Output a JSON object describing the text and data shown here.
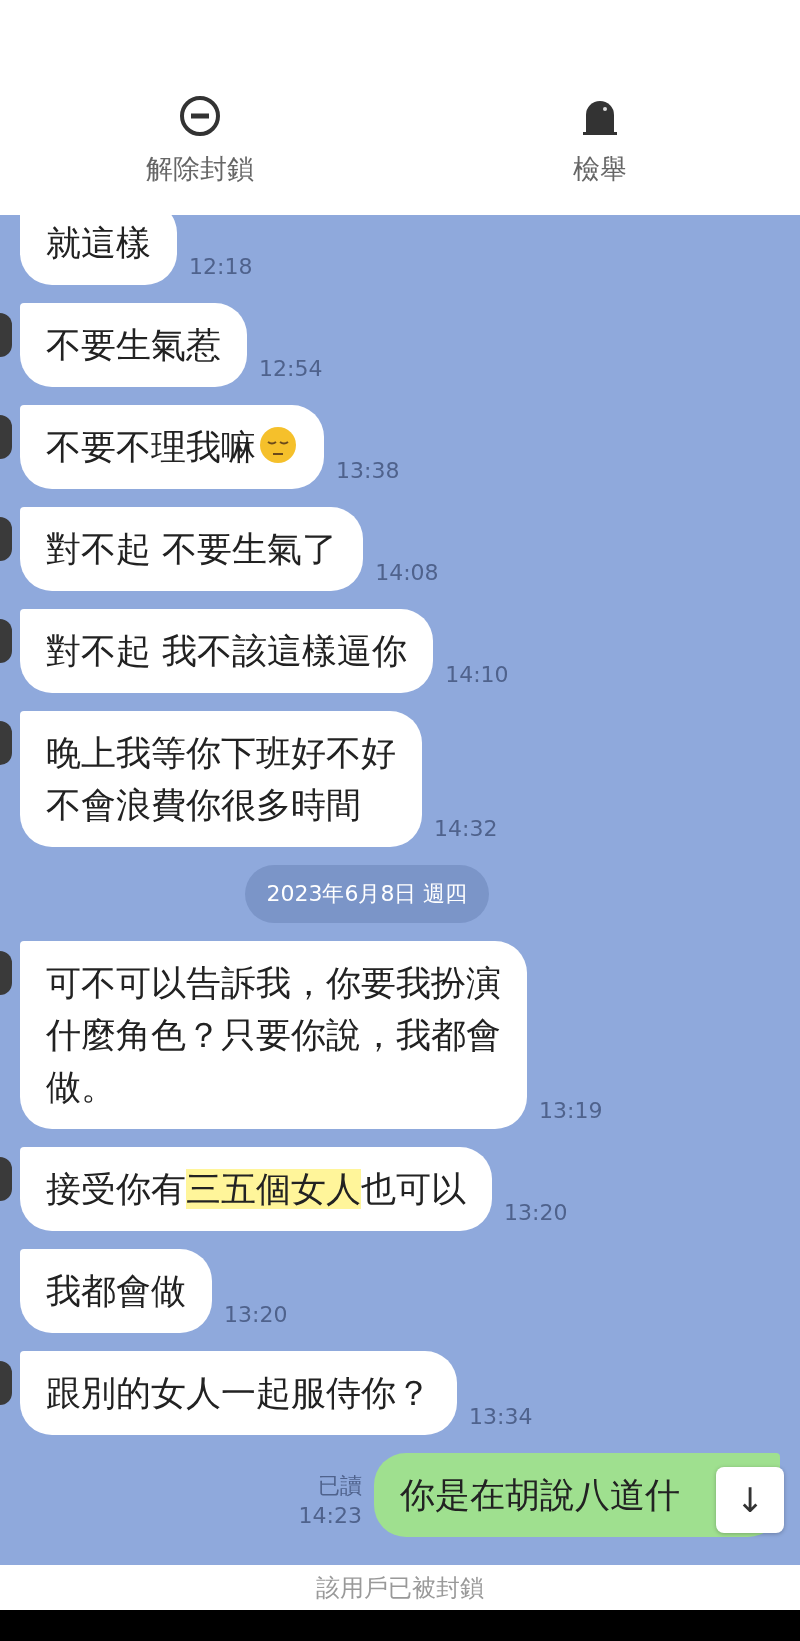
{
  "actions": [
    {
      "kind": "unblock",
      "label": "解除封鎖"
    },
    {
      "kind": "report",
      "label": "檢舉"
    }
  ],
  "messages": [
    {
      "kind": "received",
      "avatar": false,
      "lines": [
        [
          {
            "text": "就這樣"
          }
        ]
      ],
      "time": "12:18"
    },
    {
      "kind": "received",
      "avatar": true,
      "lines": [
        [
          {
            "text": "不要生氣惹"
          }
        ]
      ],
      "time": "12:54"
    },
    {
      "kind": "received",
      "avatar": true,
      "lines": [
        [
          {
            "text": "不要不理我嘛"
          }
        ]
      ],
      "has_emoji": true,
      "time": "13:38"
    },
    {
      "kind": "received",
      "avatar": true,
      "lines": [
        [
          {
            "text": "對不起 不要生氣了"
          }
        ]
      ],
      "time": "14:08"
    },
    {
      "kind": "received",
      "avatar": true,
      "lines": [
        [
          {
            "text": "對不起 我不該這樣逼你"
          }
        ]
      ],
      "time": "14:10"
    },
    {
      "kind": "received",
      "avatar": true,
      "lines": [
        [
          {
            "text": "晚上我等你下班好不好"
          }
        ],
        [
          {
            "text": "不會浪費你很多時間"
          }
        ]
      ],
      "time": "14:32"
    },
    {
      "kind": "date",
      "text": "2023年6月8日 週四"
    },
    {
      "kind": "received",
      "avatar": true,
      "lines": [
        [
          {
            "text": "可不可以告訴我，你要我扮演"
          }
        ],
        [
          {
            "text": "什麼角色？只要你說，我都會"
          }
        ],
        [
          {
            "text": "做。"
          }
        ]
      ],
      "time": "13:19"
    },
    {
      "kind": "received",
      "avatar": true,
      "lines": [
        [
          {
            "text": "接受你有"
          },
          {
            "text": "三五個女人",
            "highlight": true
          },
          {
            "text": "也可以"
          }
        ]
      ],
      "time": "13:20"
    },
    {
      "kind": "received",
      "avatar": false,
      "lines": [
        [
          {
            "text": "我都會做"
          }
        ]
      ],
      "time": "13:20"
    },
    {
      "kind": "received",
      "avatar": true,
      "lines": [
        [
          {
            "text": "跟別的女人一起服侍你？"
          }
        ]
      ],
      "time": "13:34"
    },
    {
      "kind": "sent",
      "read": "已讀",
      "lines": [
        [
          {
            "text": "你是在胡說八道什"
          }
        ]
      ],
      "time": "14:23"
    }
  ],
  "scroll_down_button": {
    "label": "↓"
  },
  "footer": {
    "text": "該用戶已被封鎖"
  }
}
